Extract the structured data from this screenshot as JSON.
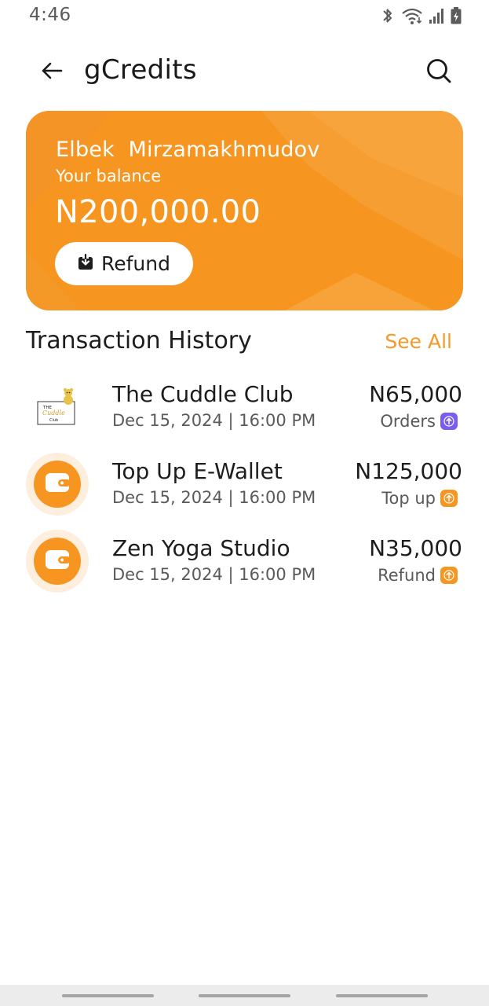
{
  "status_bar": {
    "time": "4:46",
    "icons": [
      "bluetooth-icon",
      "wifi-icon",
      "signal-icon",
      "battery-charging-icon"
    ]
  },
  "header": {
    "back_icon": "arrow-left-icon",
    "title": "gCredits",
    "search_icon": "search-icon"
  },
  "balance_card": {
    "user_name": "Elbek  Mirzamakhmudov",
    "balance_label": "Your balance",
    "balance_amount": "N200,000.00",
    "refund_button_label": "Refund",
    "refund_icon": "download-icon",
    "accent_color": "#f6951f"
  },
  "transactions": {
    "title": "Transaction History",
    "see_all_label": "See All",
    "items": [
      {
        "name": "The Cuddle Club",
        "date": "Dec 15, 2024 | 16:00 PM",
        "amount": "N65,000",
        "type": "Orders",
        "badge_color": "#7a5cf0",
        "badge_icon": "arrow-up-icon",
        "thumb": "cuddle-club-logo",
        "logo_text": {
          "line1": "THE",
          "line2": "Cuddle",
          "line3": "Club"
        }
      },
      {
        "name": "Top Up E-Wallet",
        "date": "Dec 15, 2024 | 16:00 PM",
        "amount": "N125,000",
        "type": "Top up",
        "badge_color": "#f6951f",
        "badge_icon": "arrow-up-icon",
        "thumb": "wallet-icon"
      },
      {
        "name": "Zen Yoga Studio",
        "date": "Dec 15, 2024 | 16:00 PM",
        "amount": "N35,000",
        "type": "Refund",
        "badge_color": "#f6951f",
        "badge_icon": "arrow-up-icon",
        "thumb": "wallet-icon"
      }
    ]
  }
}
